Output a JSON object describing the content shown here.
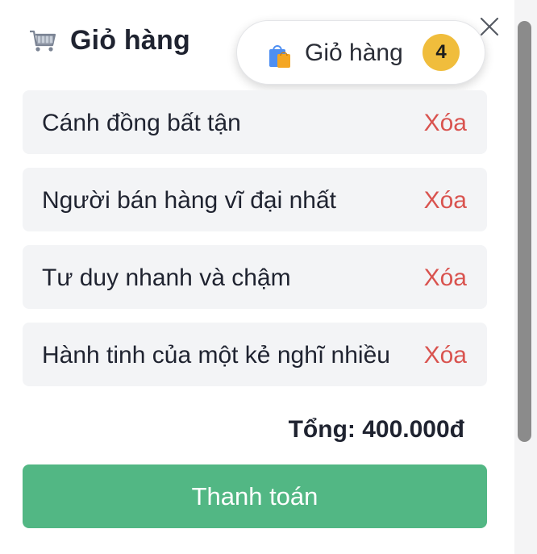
{
  "header": {
    "title": "Giỏ hàng",
    "title_icon": "shopping-cart-icon",
    "close_icon": "close-icon"
  },
  "cart_pill": {
    "label": "Giỏ hàng",
    "icon": "shopping-bag-icon",
    "count": "4"
  },
  "items": [
    {
      "name": "Cánh đồng bất tận",
      "remove_label": "Xóa"
    },
    {
      "name": "Người bán hàng vĩ đại nhất",
      "remove_label": "Xóa"
    },
    {
      "name": "Tư duy nhanh và chậm",
      "remove_label": "Xóa"
    },
    {
      "name": "Hành tinh của một kẻ nghĩ nhiều",
      "remove_label": "Xóa"
    }
  ],
  "total": "Tổng: 400.000đ",
  "checkout_label": "Thanh toán",
  "colors": {
    "remove": "#d9534f",
    "checkout": "#52b784",
    "badge": "#f0bd3c"
  }
}
